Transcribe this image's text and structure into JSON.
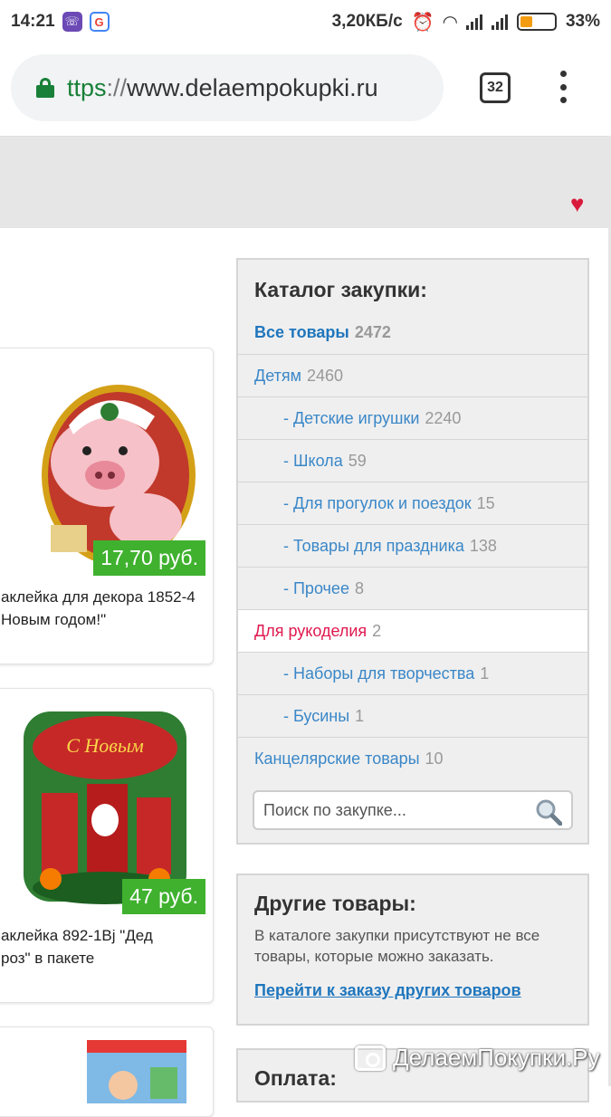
{
  "status": {
    "time": "14:21",
    "speed": "3,20КБ/с",
    "battery": "33%",
    "app_icons": [
      "viber-icon",
      "google-icon"
    ]
  },
  "browser": {
    "url_proto": "ttps",
    "url_sep": "://",
    "url_host": "www.delaempokupki.ru",
    "tab_count": "32"
  },
  "products": [
    {
      "price": "17,70 руб.",
      "desc_line1": "аклейка для декора 1852-4",
      "desc_line2": "Новым годом!\""
    },
    {
      "price": "47 руб.",
      "desc_line1": "аклейка 892-1Bj \"Дед",
      "desc_line2": "роз\" в пакете"
    }
  ],
  "catalog": {
    "title": "Каталог закупки:",
    "items": [
      {
        "label": "Все товары",
        "count": "2472"
      },
      {
        "label": "Детям",
        "count": "2460"
      },
      {
        "label": "- Детские игрушки",
        "count": "2240"
      },
      {
        "label": "- Школа",
        "count": "59"
      },
      {
        "label": "- Для прогулок и поездок",
        "count": "15"
      },
      {
        "label": "- Товары для праздника",
        "count": "138"
      },
      {
        "label": "- Прочее",
        "count": "8"
      },
      {
        "label": "Для рукоделия",
        "count": "2"
      },
      {
        "label": "- Наборы для творчества",
        "count": "1"
      },
      {
        "label": "- Бусины",
        "count": "1"
      },
      {
        "label": "Канцелярские товары",
        "count": "10"
      }
    ],
    "search_placeholder": "Поиск по закупке..."
  },
  "other": {
    "title": "Другие товары:",
    "text": "В каталоге закупки присутствуют не все товары, которые можно заказать.",
    "link": "Перейти к заказу других товаров"
  },
  "payment": {
    "title": "Оплата:"
  },
  "watermark": "ДелаемПокупки.Ру",
  "colors": {
    "price_bg": "#3fb12e",
    "link": "#1f76bd",
    "active": "#e0194f"
  }
}
